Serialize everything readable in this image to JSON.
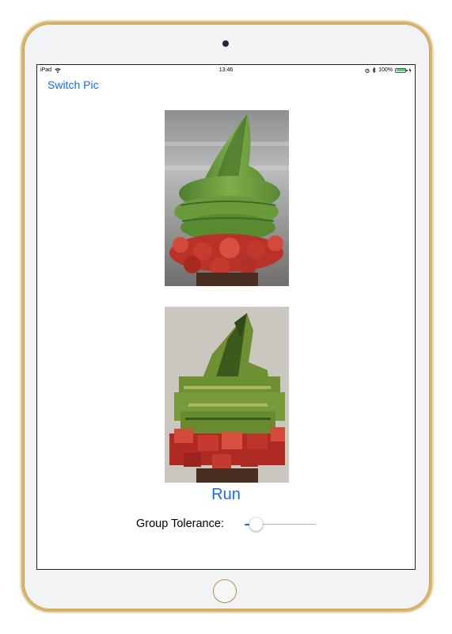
{
  "status_bar": {
    "device": "iPad",
    "time": "13:46",
    "battery_text": "100%",
    "battery_level": 1.0
  },
  "nav": {
    "switch_pic_label": "Switch Pic"
  },
  "images": {
    "original": "matcha soft-serve ice cream photo",
    "grouped": "color-grouped version of the matcha soft-serve photo"
  },
  "actions": {
    "run_label": "Run"
  },
  "tolerance": {
    "label": "Group Tolerance:",
    "value_fraction": 0.08
  },
  "colors": {
    "accent": "#1a66ff",
    "battery": "#4cd964",
    "device_frame": "#d9b36e"
  }
}
